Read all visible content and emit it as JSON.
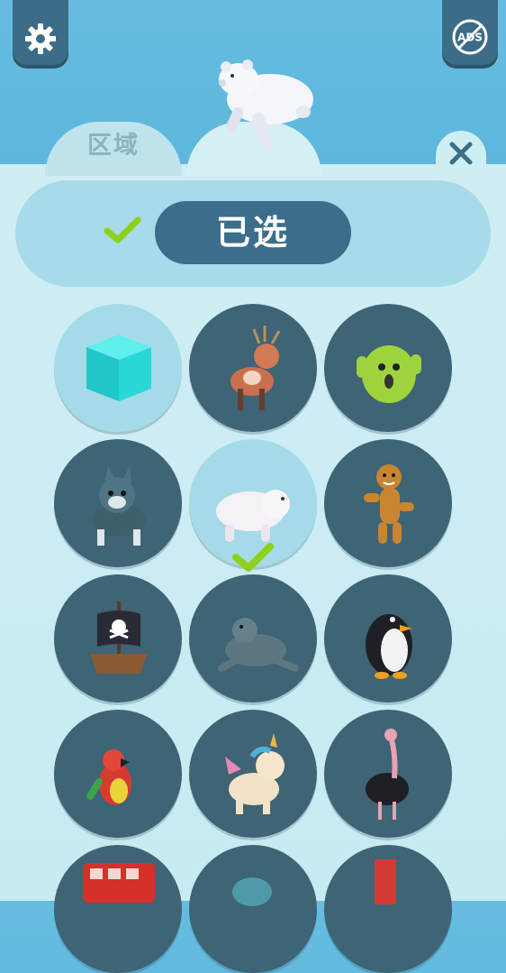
{
  "header": {
    "settings_icon": "gear-icon",
    "no_ads_icon": "no-ads-icon",
    "no_ads_text": "ADS"
  },
  "tabs": [
    {
      "label": "区域"
    },
    {
      "label": ""
    }
  ],
  "close_icon": "close-icon",
  "selection": {
    "status_label": "已选",
    "check_icon": "check-icon"
  },
  "skins": [
    {
      "name": "cube",
      "selected": false,
      "highlighted": true
    },
    {
      "name": "deer",
      "selected": false
    },
    {
      "name": "cactus",
      "selected": false
    },
    {
      "name": "wolf",
      "selected": false
    },
    {
      "name": "polar-bear",
      "selected": true
    },
    {
      "name": "gingerbread-man",
      "selected": false
    },
    {
      "name": "pirate-ship",
      "selected": false
    },
    {
      "name": "seal",
      "selected": false
    },
    {
      "name": "penguin",
      "selected": false
    },
    {
      "name": "parrot",
      "selected": false
    },
    {
      "name": "unicorn",
      "selected": false
    },
    {
      "name": "ostrich",
      "selected": false
    },
    {
      "name": "double-decker-bus",
      "selected": false
    },
    {
      "name": "round-item",
      "selected": false
    },
    {
      "name": "red-item",
      "selected": false
    }
  ],
  "colors": {
    "sky": "#66bde0",
    "panel": "#a8dbea",
    "button": "#3b6e8b",
    "cell": "#3e6475",
    "check": "#8ed01c"
  }
}
